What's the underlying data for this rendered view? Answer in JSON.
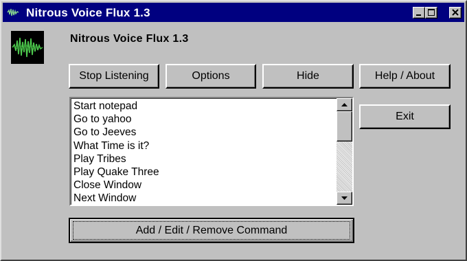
{
  "window": {
    "title": "Nitrous Voice Flux 1.3",
    "controls": [
      "minimize",
      "maximize",
      "close"
    ]
  },
  "header": {
    "app_icon": "waveform-icon",
    "app_title": "Nitrous Voice Flux 1.3"
  },
  "toolbar": {
    "stop_listening_label": "Stop Listening",
    "options_label": "Options",
    "hide_label": "Hide",
    "help_about_label": "Help / About",
    "exit_label": "Exit"
  },
  "commands": [
    "Start notepad",
    "Go to yahoo",
    "Go to Jeeves",
    "What Time is it?",
    "Play Tribes",
    "Play Quake Three",
    "Close Window",
    "Next Window"
  ],
  "footer": {
    "add_edit_remove_label": "Add / Edit / Remove Command"
  },
  "colors": {
    "titlebar": "#000080",
    "face": "#c0c0c0",
    "waveform": "#4ec94e"
  }
}
